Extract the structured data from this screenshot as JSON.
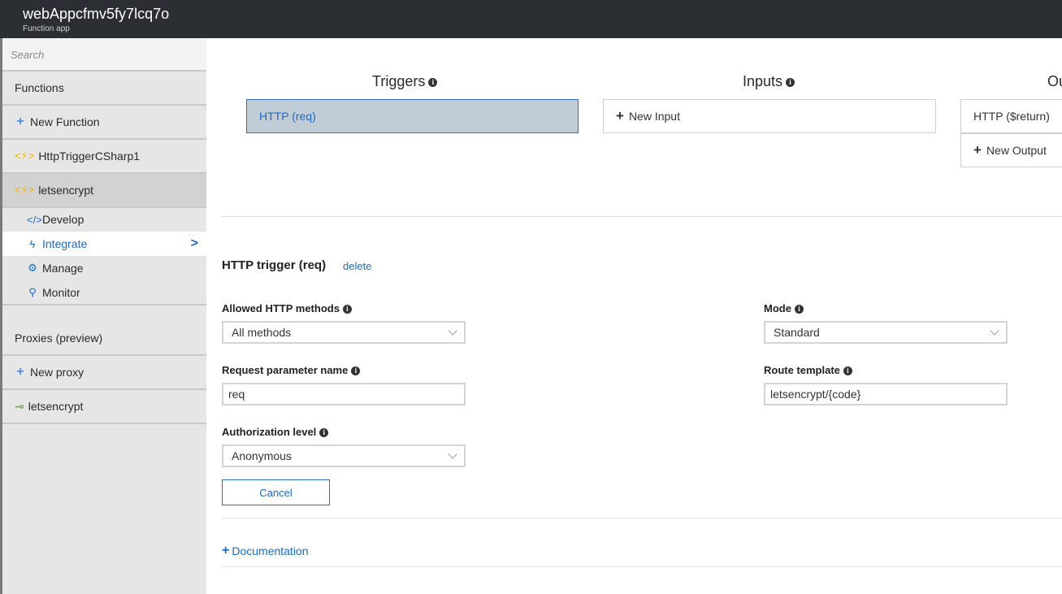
{
  "header": {
    "app_name": "webAppcfmv5fy7lcq7o",
    "app_type": "Function app"
  },
  "sidebar": {
    "search_placeholder": "Search",
    "functions_label": "Functions",
    "new_function_label": "New Function",
    "function_1": "HttpTriggerCSharp1",
    "function_2": "letsencrypt",
    "sub_items": [
      "Develop",
      "Integrate",
      "Manage",
      "Monitor"
    ],
    "proxies_label": "Proxies (preview)",
    "new_proxy_label": "New proxy",
    "proxy_1": "letsencrypt"
  },
  "integrate": {
    "triggers_title": "Triggers",
    "inputs_title": "Inputs",
    "outputs_title": "Ou",
    "trigger_item": "HTTP (req)",
    "new_input_label": "New Input",
    "output_item": "HTTP ($return)",
    "new_output_label": "New Output"
  },
  "trigger_detail": {
    "title": "HTTP trigger (req)",
    "delete_label": "delete",
    "allowed_methods_label": "Allowed HTTP methods",
    "allowed_methods_value": "All methods",
    "request_param_label": "Request parameter name",
    "request_param_value": "req",
    "auth_level_label": "Authorization level",
    "auth_level_value": "Anonymous",
    "mode_label": "Mode",
    "mode_value": "Standard",
    "route_template_label": "Route template",
    "route_template_value": "letsencrypt/{code}",
    "cancel_label": "Cancel",
    "documentation_label": "Documentation"
  }
}
